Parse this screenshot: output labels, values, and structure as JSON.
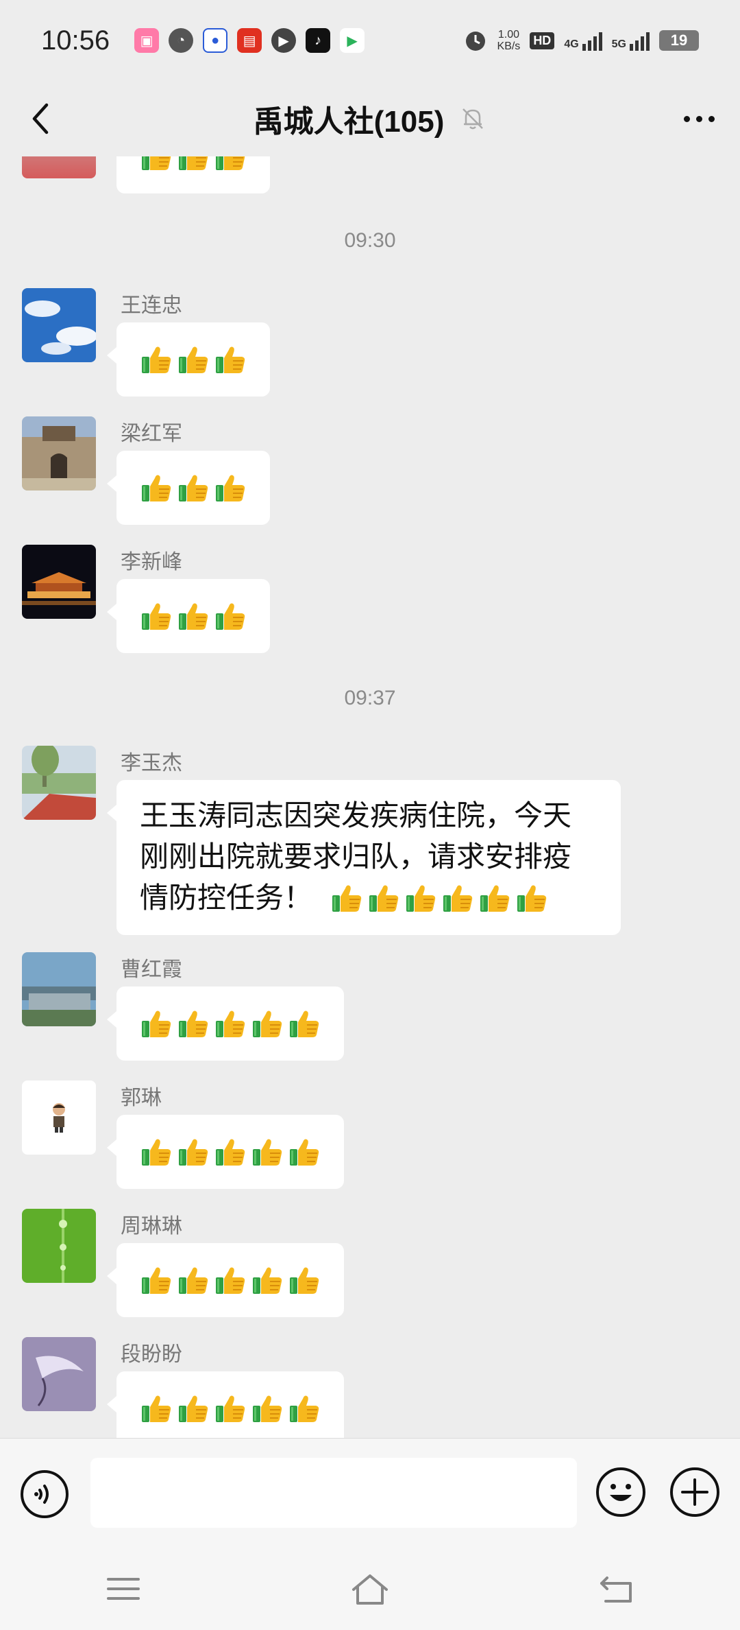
{
  "status_bar": {
    "time": "10:56",
    "net_speed_value": "1.00",
    "net_speed_unit": "KB/s",
    "hd_label": "HD",
    "sim1_label": "4G",
    "sim2_label": "5G",
    "battery": "19"
  },
  "header": {
    "title": "禹城人社(105)",
    "back_icon": "chevron-left-icon",
    "mute_icon": "bell-off-icon",
    "more_icon": "more-dots-icon"
  },
  "messages": {
    "time_1": "09:30",
    "time_2": "09:37",
    "items": [
      {
        "sender": "王连忠",
        "thumbs": 3
      },
      {
        "sender": "梁红军",
        "thumbs": 3
      },
      {
        "sender": "李新峰",
        "thumbs": 3
      },
      {
        "sender": "李玉杰",
        "line1": "王玉涛同志因突发疾病住院，今天",
        "line2": "刚刚出院就要求归队，请求安排疫",
        "line3": "情防控任务！",
        "thumbs": 6
      },
      {
        "sender": "曹红霞",
        "thumbs": 5
      },
      {
        "sender": "郭琳",
        "thumbs": 5
      },
      {
        "sender": "周琳琳",
        "thumbs": 5
      },
      {
        "sender": "段盼盼",
        "thumbs": 5
      }
    ]
  },
  "input_bar": {
    "voice_icon": "voice-icon",
    "emoji_icon": "emoji-icon",
    "plus_icon": "plus-icon",
    "placeholder": ""
  },
  "nav_bar": {
    "menu_icon": "menu-icon",
    "home_icon": "home-icon",
    "back_icon": "back-icon"
  },
  "colors": {
    "background": "#ededed",
    "bubble": "#ffffff",
    "thumb_yellow": "#f5b71e",
    "thumb_green": "#3aa842"
  }
}
